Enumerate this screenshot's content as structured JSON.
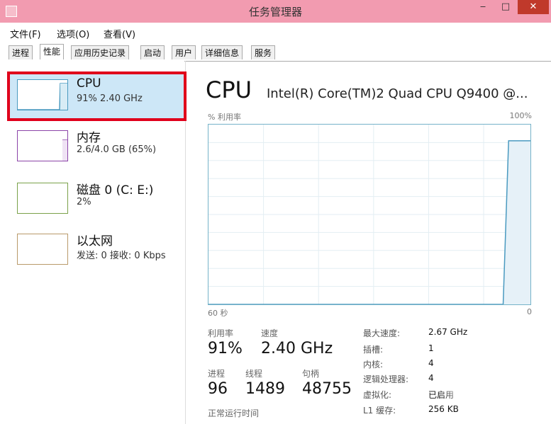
{
  "window": {
    "title": "任务管理器",
    "min": "‒",
    "max": "□",
    "close": "✕"
  },
  "menu": [
    "文件(F)",
    "选项(O)",
    "查看(V)"
  ],
  "tabs": [
    "进程",
    "性能",
    "应用历史记录",
    "启动",
    "用户",
    "详细信息",
    "服务"
  ],
  "resources": [
    {
      "title": "CPU",
      "sub": "91% 2.40 GHz"
    },
    {
      "title": "内存",
      "sub": "2.6/4.0 GB (65%)"
    },
    {
      "title": "磁盘 0 (C: E:)",
      "sub": "2%"
    },
    {
      "title": "以太网",
      "sub": "发送: 0 接收: 0 Kbps"
    }
  ],
  "detail": {
    "title": "CPU",
    "model": "Intel(R) Core(TM)2 Quad CPU Q9400 @...",
    "graph_label_left": "% 利用率",
    "graph_label_right": "100%",
    "time_left": "60 秒",
    "time_right": "0",
    "util_label": "利用率",
    "util_value": "91%",
    "speed_label": "速度",
    "speed_value": "2.40 GHz",
    "proc_label": "进程",
    "proc_value": "96",
    "threads_label": "线程",
    "threads_value": "1489",
    "handles_label": "句柄",
    "handles_value": "48755",
    "uptime_label": "正常运行时间",
    "specs": [
      {
        "label": "最大速度:",
        "value": "2.67 GHz"
      },
      {
        "label": "插槽:",
        "value": "1"
      },
      {
        "label": "内核:",
        "value": "4"
      },
      {
        "label": "逻辑处理器:",
        "value": "4"
      },
      {
        "label": "虚拟化:",
        "value": "已启用"
      },
      {
        "label": "L1 缓存:",
        "value": "256 KB"
      }
    ],
    "graph_series": [
      0,
      0,
      0,
      0,
      0,
      0,
      0,
      0,
      0,
      0,
      0,
      0,
      0,
      0,
      0,
      0,
      0,
      0,
      0,
      0,
      0,
      0,
      0,
      0,
      0,
      0,
      0,
      0,
      0,
      0,
      0,
      0,
      0,
      0,
      0,
      0,
      0,
      0,
      0,
      0,
      0,
      0,
      0,
      0,
      0,
      0,
      0,
      0,
      0,
      0,
      0,
      0,
      0,
      0,
      0,
      91,
      91,
      91,
      91,
      91
    ]
  },
  "colors": {
    "titlebar": "#f29bb0",
    "selection": "#cde7f7",
    "highlight": "#e0001b",
    "cpu_line": "#4a9ac0",
    "mem_line": "#8b44a8",
    "disk_line": "#7aa14a",
    "net_line": "#b99a6a"
  }
}
